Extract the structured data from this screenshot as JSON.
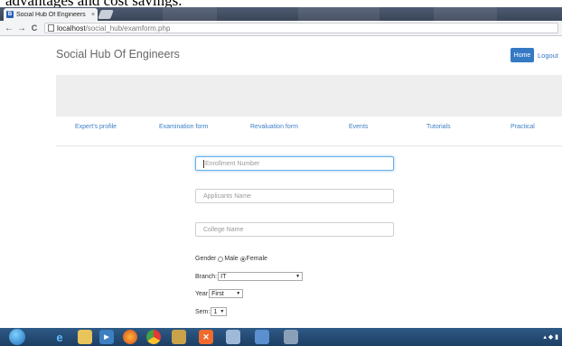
{
  "caption": "advantages and cost savings.",
  "browser": {
    "tab": {
      "favicon_letter": "B",
      "title": "Social Hub Of Engineers",
      "close": "×"
    },
    "nav": {
      "back": "←",
      "forward": "→",
      "reload": "C"
    },
    "address": {
      "host": "localhost",
      "path": "/social_hub/examform.php"
    }
  },
  "page": {
    "brand": "Social Hub Of Engineers",
    "home_button": "Home",
    "logout_link": "Logout",
    "nav_links": [
      "Expert's profile",
      "Examination form",
      "Revaluation form",
      "Events",
      "Tutorials",
      "Practical"
    ],
    "form": {
      "enrollment_placeholder": "Enrollment Number",
      "applicant_placeholder": "Applicants Name",
      "college_placeholder": "College Name",
      "gender_label": "Gender",
      "gender_options": [
        "Male",
        "Female"
      ],
      "gender_selected": "Female",
      "branch_label": "Branch:",
      "branch_value": "IT",
      "year_label": "Year",
      "year_value": "First",
      "sem_label": "Sem:",
      "sem_value": "1"
    }
  },
  "taskbar": {
    "icons": [
      "start-orb",
      "ie",
      "explorer",
      "media-player",
      "firefox",
      "chrome",
      "app",
      "xampp",
      "app2",
      "app3",
      "paint"
    ]
  },
  "colors": {
    "accent": "#3579c4",
    "link": "#3f80c6",
    "jumbotron": "#eeeeee",
    "taskbar": "#1d3e63"
  }
}
